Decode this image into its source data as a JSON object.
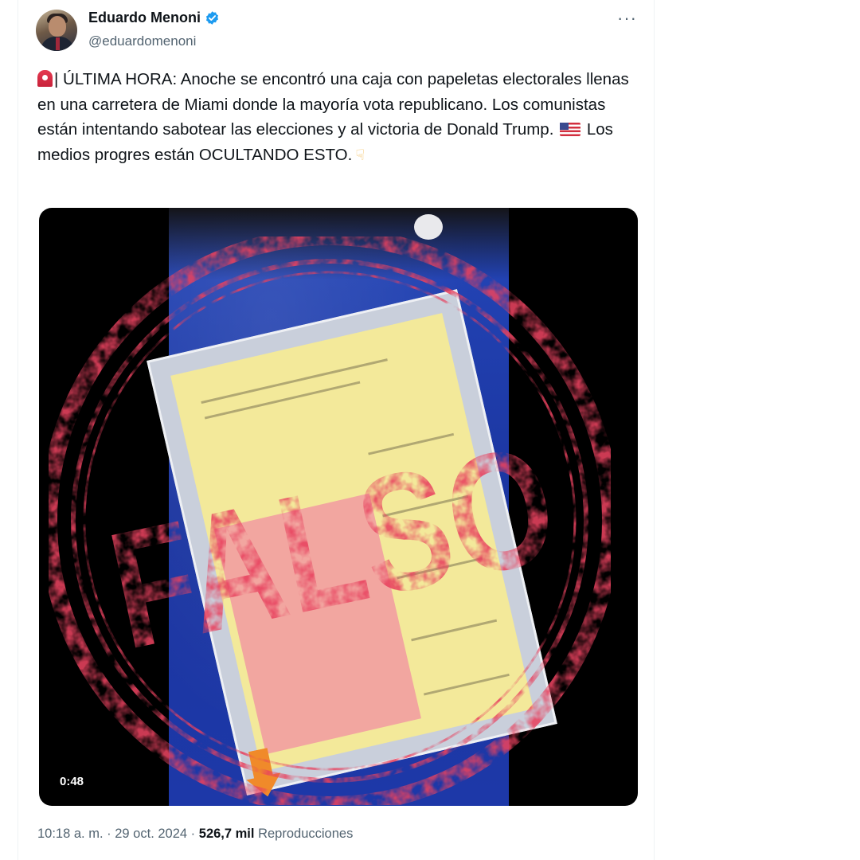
{
  "author": {
    "name": "Eduardo Menoni",
    "handle": "@eduardomenoni",
    "verified": true
  },
  "post": {
    "text_part1": "| ÚLTIMA HORA: Anoche se encontró una caja con papeletas electorales llenas en una carretera de Miami donde la mayoría vota republicano. Los comunistas están intentando sabotear las elecciones y al victoria de Donald Trump.",
    "text_part2": "Los medios progres están OCULTANDO ESTO.",
    "emojis": [
      "rotating-light",
      "us-flag",
      "backhand-index-pointing-down"
    ]
  },
  "media": {
    "duration": "0:48",
    "stamp_text": "FALSO"
  },
  "meta": {
    "time": "10:18 a. m.",
    "date": "29 oct. 2024",
    "views": "526,7 mil",
    "views_label": "Reproducciones",
    "separator": "·"
  },
  "colors": {
    "stamp": "#e8425f",
    "verified": "#1d9bf0",
    "text_secondary": "#536471"
  }
}
